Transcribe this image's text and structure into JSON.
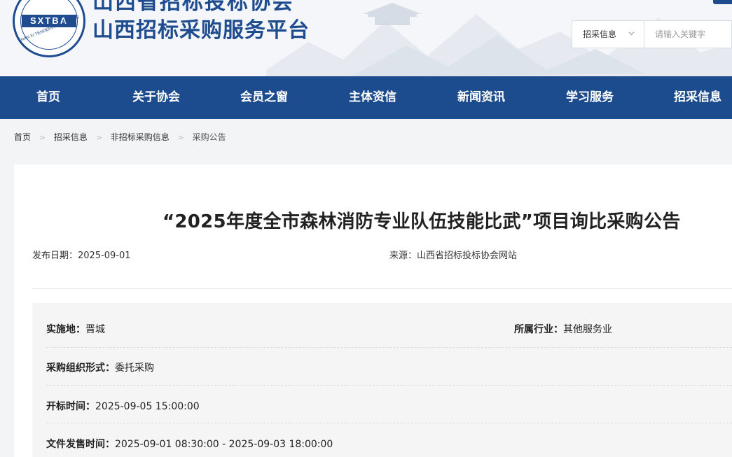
{
  "header": {
    "title_top": "山西省招标投标协会",
    "title_main": "山西招标采购服务平台",
    "logo_text": "SXTBA",
    "logo_ring_text": "SHAN XI TENDERING & BIDDING"
  },
  "search": {
    "category": "招采信息",
    "placeholder": "请输入关键字"
  },
  "nav": {
    "items": [
      "首页",
      "关于协会",
      "会员之窗",
      "主体资信",
      "新闻资讯",
      "学习服务",
      "招采信息"
    ]
  },
  "breadcrumb": {
    "items": [
      "首页",
      "招采信息",
      "非招标采购信息",
      "采购公告"
    ]
  },
  "article": {
    "title": "“2025年度全市森林消防专业队伍技能比武”项目询比采购公告",
    "publish_date": "发布日期：2025-09-01",
    "source": "来源：山西省招标投标协会网站"
  },
  "details": {
    "location_label": "实施地：",
    "location_value": "晋城",
    "industry_label": "所属行业：",
    "industry_value": "其他服务业",
    "org_form_label": "采购组织形式：",
    "org_form_value": "委托采购",
    "open_time_label": "开标时间：",
    "open_time_value": "2025-09-05 15:00:00",
    "sale_time_label": "文件发售时间：",
    "sale_time_value": "2025-09-01 08:30:00 - 2025-09-03 18:00:00"
  },
  "colors": {
    "brand_blue": "#1d4c8e",
    "page_bg": "#f3f4f6"
  }
}
